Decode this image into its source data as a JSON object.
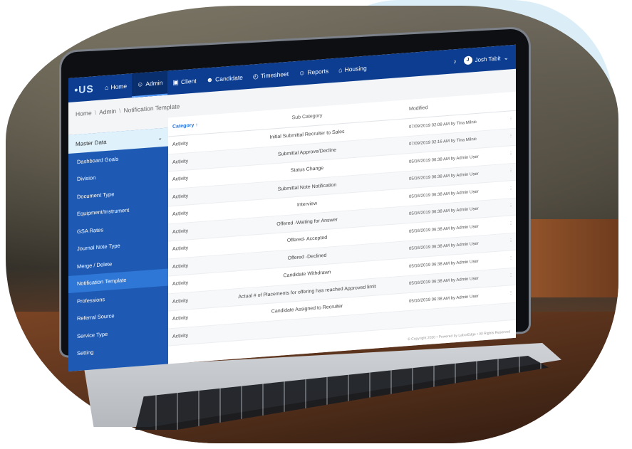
{
  "topbar": {
    "logo": "•US",
    "nav": [
      {
        "label": "Home",
        "icon": "home-icon",
        "glyph": "⌂"
      },
      {
        "label": "Admin",
        "icon": "admin-icon",
        "glyph": "☺"
      },
      {
        "label": "Client",
        "icon": "client-icon",
        "glyph": "▣"
      },
      {
        "label": "Candidate",
        "icon": "candidate-icon",
        "glyph": "☻"
      },
      {
        "label": "Timesheet",
        "icon": "clock-icon",
        "glyph": "◴"
      },
      {
        "label": "Reports",
        "icon": "reports-icon",
        "glyph": "☺"
      },
      {
        "label": "Housing",
        "icon": "housing-icon",
        "glyph": "⌂"
      }
    ],
    "active": "Admin",
    "bell_glyph": "♪",
    "user_name": "Josh Tabit",
    "user_initial": "J",
    "chevron": "⌄"
  },
  "breadcrumb": [
    "Home",
    "Admin",
    "Notification Template"
  ],
  "sidebar": {
    "header": "Master Data",
    "chevron": "⌄",
    "items": [
      "Dashboard Goals",
      "Division",
      "Document Type",
      "Equipment/Instrument",
      "GSA Rates",
      "Journal Note Type",
      "Merge / Delete",
      "Notification Template",
      "Professions",
      "Referral Source",
      "Service Type",
      "Setting"
    ],
    "selected": "Notification Template"
  },
  "table": {
    "headers": {
      "category": "Category",
      "sort_glyph": "↑",
      "sub_category": "Sub Category",
      "modified": "Modified"
    },
    "rows": [
      {
        "category": "Activity",
        "sub_category": "Initial Submittal Recruiter to Sales",
        "modified": "07/09/2019 02:08 AM by Tina Milnic"
      },
      {
        "category": "Activity",
        "sub_category": "Submittal Approve/Decline",
        "modified": "07/09/2019 02:16 AM by Tina Milnic"
      },
      {
        "category": "Activity",
        "sub_category": "Status Change",
        "modified": "05/16/2019 06:38 AM by Admin User"
      },
      {
        "category": "Activity",
        "sub_category": "Submittal Note Notification",
        "modified": "05/16/2019 06:38 AM by Admin User"
      },
      {
        "category": "Activity",
        "sub_category": "Interview",
        "modified": "05/16/2019 06:38 AM by Admin User"
      },
      {
        "category": "Activity",
        "sub_category": "Offered -Waiting for Answer",
        "modified": "05/16/2019 06:38 AM by Admin User"
      },
      {
        "category": "Activity",
        "sub_category": "Offered- Accepted",
        "modified": "05/16/2019 06:38 AM by Admin User"
      },
      {
        "category": "Activity",
        "sub_category": "Offered -Declined",
        "modified": "05/16/2019 06:38 AM by Admin User"
      },
      {
        "category": "Activity",
        "sub_category": "Candidate Withdrawn",
        "modified": "05/16/2019 06:38 AM by Admin User"
      },
      {
        "category": "Activity",
        "sub_category": "Actual # of Placements for offering has reached Approved limit",
        "modified": "05/16/2019 06:38 AM by Admin User"
      },
      {
        "category": "Activity",
        "sub_category": "Candidate Assigned to Recruiter",
        "modified": "05/16/2019 06:38 AM by Admin User"
      },
      {
        "category": "Activity",
        "sub_category": "",
        "modified": ""
      }
    ],
    "row_menu_glyph": "⋮"
  },
  "footer": "© Copyright 2020 • Powered by LaborEdge • All Rights Reserved",
  "colors": {
    "topbar": "#0c3d91",
    "sidebar": "#1e5ab4",
    "accent": "#1e6fd9",
    "blob": "#dbeef7"
  }
}
